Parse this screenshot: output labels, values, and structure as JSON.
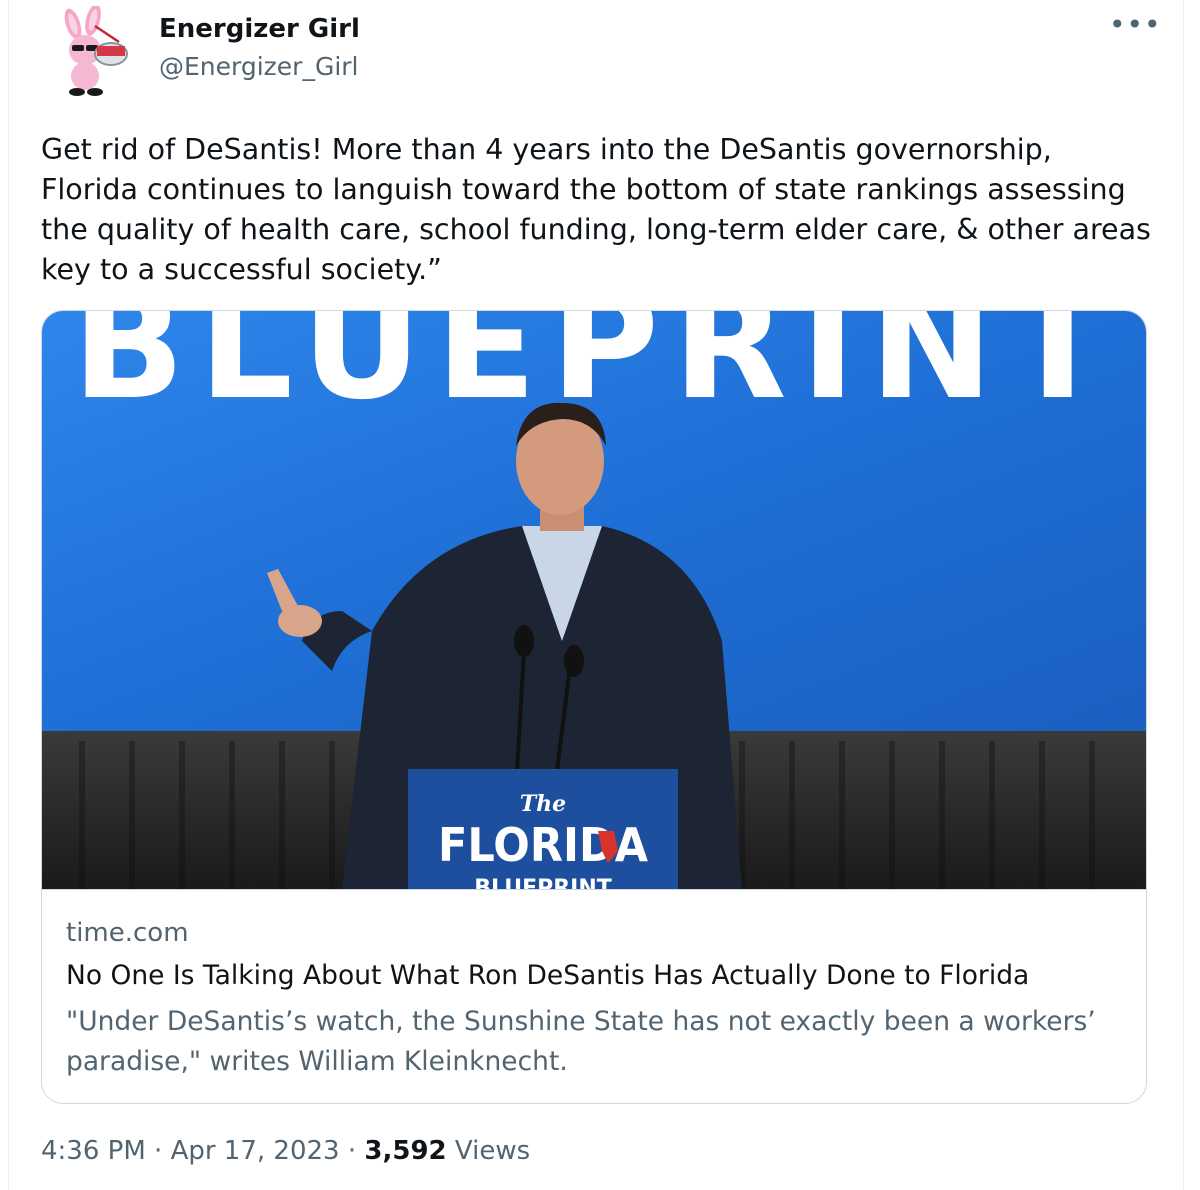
{
  "author": {
    "display_name": "Energizer Girl",
    "handle": "@Energizer_Girl",
    "avatar_icon": "pink-bunny-avatar-icon"
  },
  "more_icon": "•••",
  "tweet": {
    "text": "Get rid of DeSantis! More than 4 years into the DeSantis governorship, Florida continues to languish toward the bottom of state rankings assessing the quality of health care, school funding, long-term elder care, & other areas key to a successful society.”"
  },
  "card": {
    "image": {
      "backdrop_text": "BLUEPRINT",
      "podium_script": "The",
      "podium_title": "FLORIDA",
      "podium_sub": "BLUEPRINT"
    },
    "domain": "time.com",
    "title": "No One Is Talking About What Ron DeSantis Has Actually Done to Florida",
    "description": "\"Under DeSantis’s watch, the Sunshine State has not exactly been a workers’ paradise,\" writes William Kleinknecht."
  },
  "meta": {
    "time": "4:36 PM",
    "separator": " · ",
    "date": "Apr 17, 2023",
    "views_count": "3,592",
    "views_label": "Views"
  },
  "colors": {
    "text_primary": "#0f1419",
    "text_secondary": "#536471",
    "border": "#cfd9de",
    "backdrop_blue": "#1f6fd6"
  }
}
